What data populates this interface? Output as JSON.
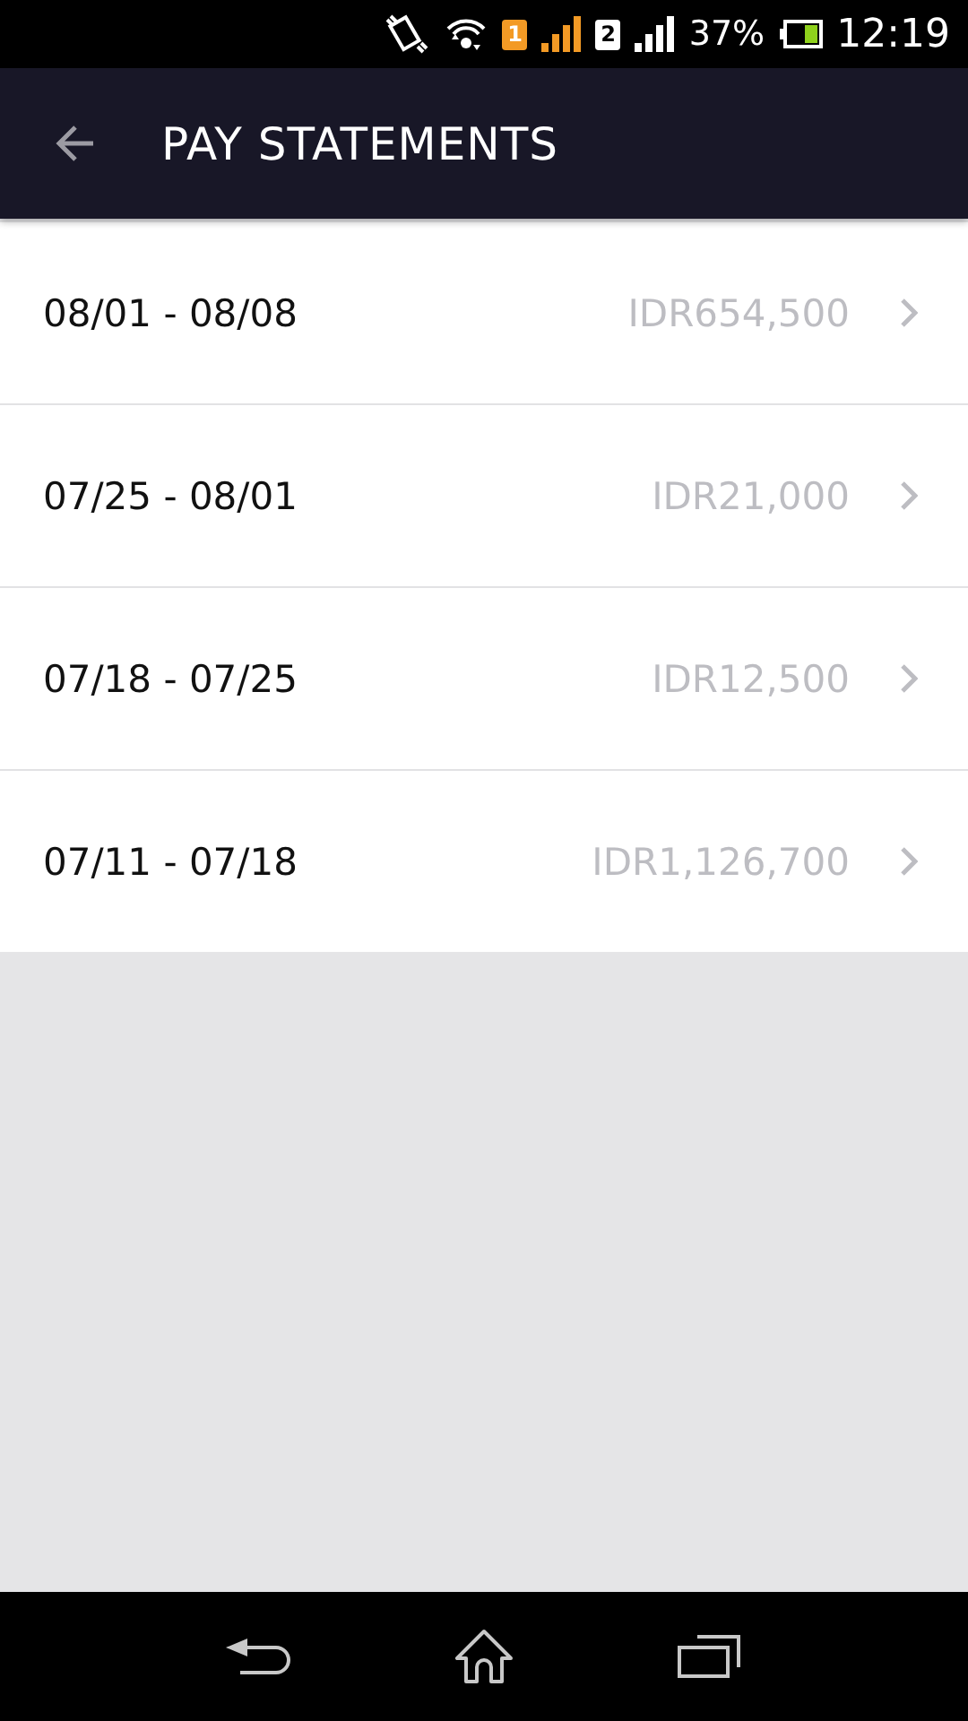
{
  "status_bar": {
    "sim_1": "1",
    "sim_2": "2",
    "battery": "37%",
    "time": "12:19"
  },
  "header": {
    "title": "PAY STATEMENTS"
  },
  "statements": [
    {
      "period": "08/01 - 08/08",
      "amount": "IDR654,500"
    },
    {
      "period": "07/25 - 08/01",
      "amount": "IDR21,000"
    },
    {
      "period": "07/18 - 07/25",
      "amount": "IDR12,500"
    },
    {
      "period": "07/11 - 07/18",
      "amount": "IDR1,126,700"
    }
  ]
}
